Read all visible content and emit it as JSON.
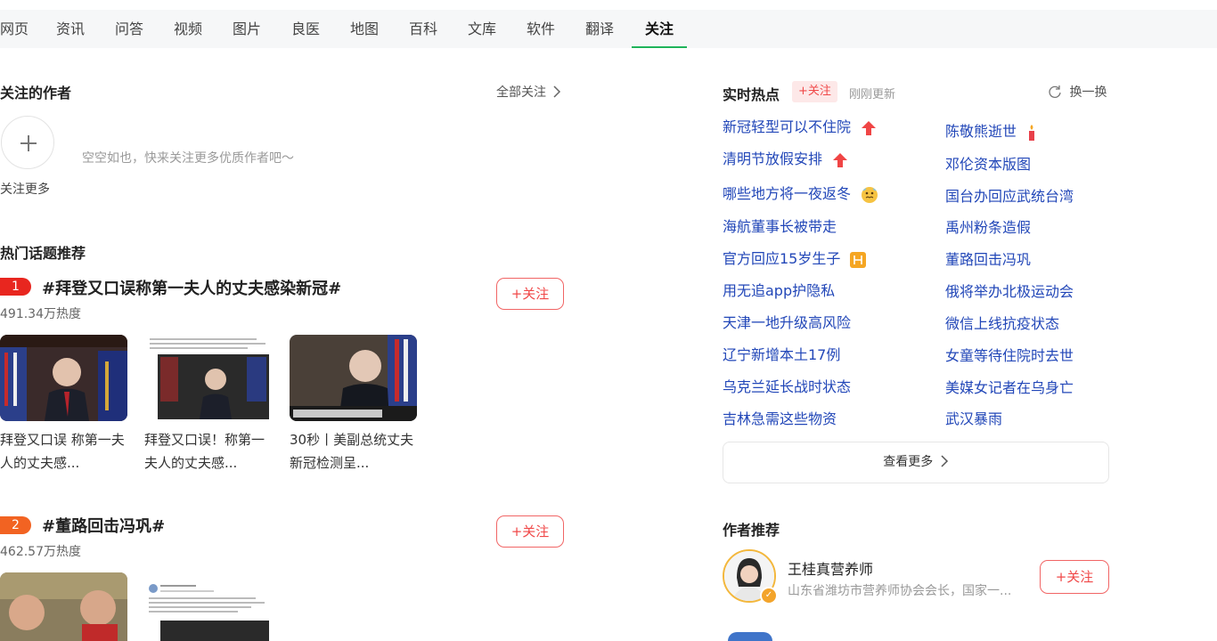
{
  "nav": {
    "tabs": [
      "网页",
      "资讯",
      "问答",
      "视频",
      "图片",
      "良医",
      "地图",
      "百科",
      "文库",
      "软件",
      "翻译",
      "关注"
    ],
    "active_index": 11
  },
  "follow": {
    "title": "关注的作者",
    "all_label": "全部关注",
    "empty_text": "空空如也，快来关注更多优质作者吧～",
    "follow_more_label": "关注更多"
  },
  "topics": {
    "title": "热门话题推荐",
    "follow_label": "+关注",
    "items": [
      {
        "rank": "1",
        "title": "#拜登又口误称第一夫人的丈夫感染新冠#",
        "heat": "491.34万热度",
        "videos": [
          {
            "caption": "拜登又口误 称第一夫人的丈夫感..."
          },
          {
            "caption": "拜登又口误！称第一夫人的丈夫感..."
          },
          {
            "caption": "30秒丨美副总统丈夫新冠检测呈..."
          }
        ]
      },
      {
        "rank": "2",
        "title": "#董路回击冯巩#",
        "heat": "462.57万热度"
      }
    ]
  },
  "hot": {
    "title": "实时热点",
    "tag": "+关注",
    "updated": "刚刚更新",
    "refresh_label": "换一换",
    "left": [
      "新冠轻型可以不住院",
      "清明节放假安排",
      "哪些地方将一夜返冬",
      "海航董事长被带走",
      "官方回应15岁生子",
      "用无追app护隐私",
      "天津一地升级高风险",
      "辽宁新增本土17例",
      "乌克兰延长战时状态",
      "吉林急需这些物资"
    ],
    "right": [
      "陈敬熊逝世",
      "邓伦资本版图",
      "国台办回应武统台湾",
      "禹州粉条造假",
      "董路回击冯巩",
      "俄将举办北极运动会",
      "微信上线抗疫状态",
      "女童等待住院时去世",
      "美媒女记者在乌身亡",
      "武汉暴雨"
    ],
    "more_label": "查看更多"
  },
  "authors": {
    "title": "作者推荐",
    "items": [
      {
        "name": "王桂真营养师",
        "desc": "山东省潍坊市营养师协会会长，国家一...",
        "follow_label": "+关注"
      }
    ]
  },
  "colors": {
    "accent_green": "#1fb45a",
    "red": "#f04848",
    "link_blue": "#2247b8",
    "rank1": "#e8261f",
    "rank2": "#f26322"
  }
}
